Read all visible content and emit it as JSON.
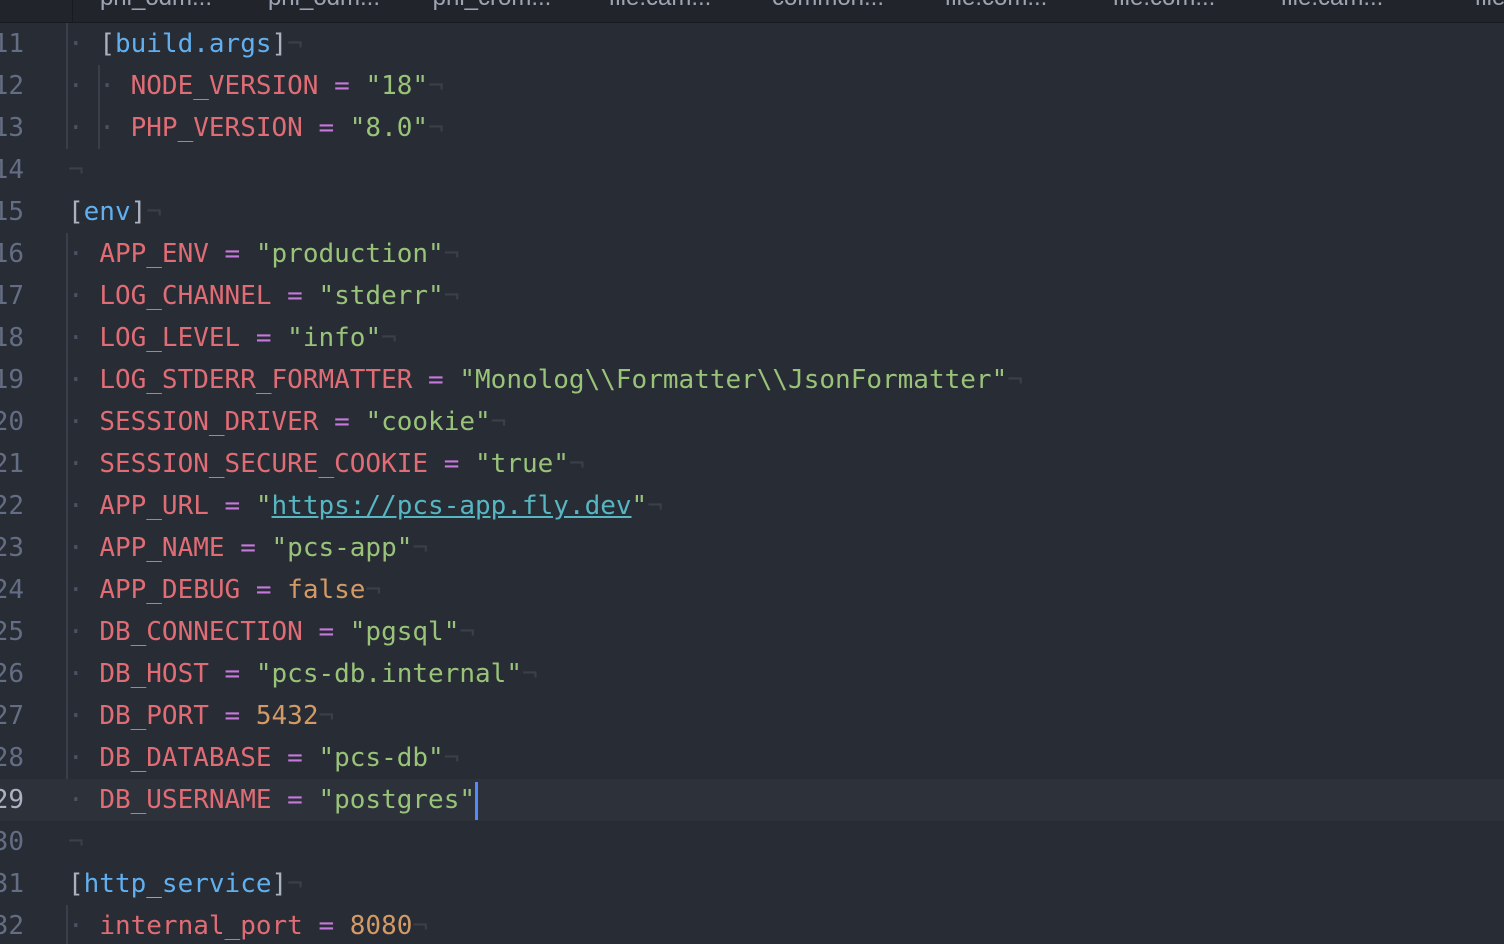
{
  "tabs": [
    {
      "label": "phi_odm..."
    },
    {
      "label": "phi_odm..."
    },
    {
      "label": "phi_crom..."
    },
    {
      "label": "file.cam..."
    },
    {
      "label": "common..."
    },
    {
      "label": "file.com..."
    },
    {
      "label": "file.com..."
    },
    {
      "label": "file.cam..."
    },
    {
      "label": "file..."
    }
  ],
  "editor": {
    "language": "toml",
    "active_line": "29",
    "lines": [
      {
        "n": "11",
        "indent": "· ",
        "parts": [
          {
            "t": "[",
            "c": "br"
          },
          {
            "t": "build.args",
            "c": "sec"
          },
          {
            "t": "]",
            "c": "br"
          }
        ],
        "eol": "¬"
      },
      {
        "n": "12",
        "indent": "· · ",
        "parts": [
          {
            "t": "NODE_VERSION",
            "c": "key"
          },
          {
            "t": " = ",
            "c": "op"
          },
          {
            "t": "\"18\"",
            "c": "str"
          }
        ],
        "eol": "¬"
      },
      {
        "n": "13",
        "indent": "· · ",
        "parts": [
          {
            "t": "PHP_VERSION",
            "c": "key"
          },
          {
            "t": " = ",
            "c": "op"
          },
          {
            "t": "\"8.0\"",
            "c": "str"
          }
        ],
        "eol": "¬"
      },
      {
        "n": "14",
        "indent": "",
        "parts": [],
        "eol": "¬"
      },
      {
        "n": "15",
        "indent": "",
        "parts": [
          {
            "t": "[",
            "c": "br"
          },
          {
            "t": "env",
            "c": "sec"
          },
          {
            "t": "]",
            "c": "br"
          }
        ],
        "eol": "¬"
      },
      {
        "n": "16",
        "indent": "· ",
        "parts": [
          {
            "t": "APP_ENV",
            "c": "key"
          },
          {
            "t": " = ",
            "c": "op"
          },
          {
            "t": "\"production\"",
            "c": "str"
          }
        ],
        "eol": "¬"
      },
      {
        "n": "17",
        "indent": "· ",
        "parts": [
          {
            "t": "LOG_CHANNEL",
            "c": "key"
          },
          {
            "t": " = ",
            "c": "op"
          },
          {
            "t": "\"stderr\"",
            "c": "str"
          }
        ],
        "eol": "¬"
      },
      {
        "n": "18",
        "indent": "· ",
        "parts": [
          {
            "t": "LOG_LEVEL",
            "c": "key"
          },
          {
            "t": " = ",
            "c": "op"
          },
          {
            "t": "\"info\"",
            "c": "str"
          }
        ],
        "eol": "¬"
      },
      {
        "n": "19",
        "indent": "· ",
        "parts": [
          {
            "t": "LOG_STDERR_FORMATTER",
            "c": "key"
          },
          {
            "t": " = ",
            "c": "op"
          },
          {
            "t": "\"Monolog\\\\Formatter\\\\JsonFormatter\"",
            "c": "str"
          }
        ],
        "eol": "¬"
      },
      {
        "n": "20",
        "indent": "· ",
        "parts": [
          {
            "t": "SESSION_DRIVER",
            "c": "key"
          },
          {
            "t": " = ",
            "c": "op"
          },
          {
            "t": "\"cookie\"",
            "c": "str"
          }
        ],
        "eol": "¬"
      },
      {
        "n": "21",
        "indent": "· ",
        "parts": [
          {
            "t": "SESSION_SECURE_COOKIE",
            "c": "key"
          },
          {
            "t": " = ",
            "c": "op"
          },
          {
            "t": "\"true\"",
            "c": "str"
          }
        ],
        "eol": "¬"
      },
      {
        "n": "22",
        "indent": "· ",
        "parts": [
          {
            "t": "APP_URL",
            "c": "key"
          },
          {
            "t": " = ",
            "c": "op"
          },
          {
            "t": "\"",
            "c": "str"
          },
          {
            "t": "https://pcs-app.fly.dev",
            "c": "url"
          },
          {
            "t": "\"",
            "c": "str"
          }
        ],
        "eol": "¬"
      },
      {
        "n": "23",
        "indent": "· ",
        "parts": [
          {
            "t": "APP_NAME",
            "c": "key"
          },
          {
            "t": " = ",
            "c": "op"
          },
          {
            "t": "\"pcs-app\"",
            "c": "str"
          }
        ],
        "eol": "¬"
      },
      {
        "n": "24",
        "indent": "· ",
        "parts": [
          {
            "t": "APP_DEBUG",
            "c": "key"
          },
          {
            "t": " = ",
            "c": "op"
          },
          {
            "t": "false",
            "c": "bool"
          }
        ],
        "eol": "¬"
      },
      {
        "n": "25",
        "indent": "· ",
        "parts": [
          {
            "t": "DB_CONNECTION",
            "c": "key"
          },
          {
            "t": " = ",
            "c": "op"
          },
          {
            "t": "\"pgsql\"",
            "c": "str"
          }
        ],
        "eol": "¬"
      },
      {
        "n": "26",
        "indent": "· ",
        "parts": [
          {
            "t": "DB_HOST",
            "c": "key"
          },
          {
            "t": " = ",
            "c": "op"
          },
          {
            "t": "\"pcs-db.internal\"",
            "c": "str"
          }
        ],
        "eol": "¬"
      },
      {
        "n": "27",
        "indent": "· ",
        "parts": [
          {
            "t": "DB_PORT",
            "c": "key"
          },
          {
            "t": " = ",
            "c": "op"
          },
          {
            "t": "5432",
            "c": "num"
          }
        ],
        "eol": "¬"
      },
      {
        "n": "28",
        "indent": "· ",
        "parts": [
          {
            "t": "DB_DATABASE",
            "c": "key"
          },
          {
            "t": " = ",
            "c": "op"
          },
          {
            "t": "\"pcs-db\"",
            "c": "str"
          }
        ],
        "eol": "¬"
      },
      {
        "n": "29",
        "indent": "· ",
        "parts": [
          {
            "t": "DB_USERNAME",
            "c": "key"
          },
          {
            "t": " = ",
            "c": "op"
          },
          {
            "t": "\"postgres\"",
            "c": "str"
          }
        ],
        "eol": "",
        "cursor": true
      },
      {
        "n": "30",
        "indent": "",
        "parts": [],
        "eol": "¬"
      },
      {
        "n": "31",
        "indent": "",
        "parts": [
          {
            "t": "[",
            "c": "br"
          },
          {
            "t": "http_service",
            "c": "sec"
          },
          {
            "t": "]",
            "c": "br"
          }
        ],
        "eol": "¬"
      },
      {
        "n": "32",
        "indent": "· ",
        "parts": [
          {
            "t": "internal_port",
            "c": "key"
          },
          {
            "t": " = ",
            "c": "op"
          },
          {
            "t": "8080",
            "c": "num"
          }
        ],
        "eol": "¬"
      }
    ]
  },
  "colors": {
    "background": "#282c34",
    "active_line": "#2c313a",
    "key": "#e06c75",
    "string": "#98c379",
    "section": "#61afef",
    "number": "#d19a66",
    "operator": "#c678dd",
    "url": "#56b6c2",
    "cursor": "#528bff"
  }
}
